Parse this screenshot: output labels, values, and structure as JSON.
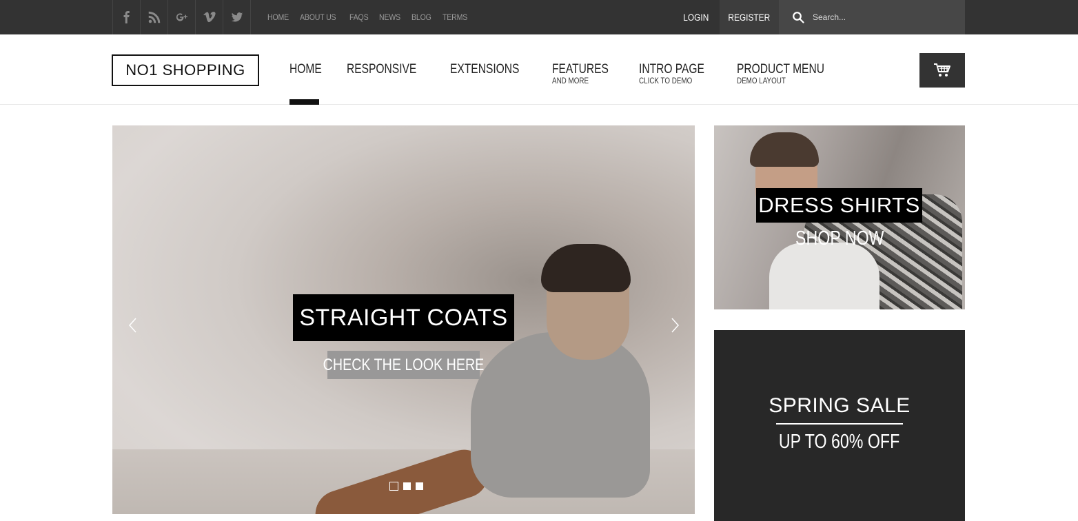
{
  "topbar": {
    "social_icons": [
      "facebook-icon",
      "rss-icon",
      "google-plus-icon",
      "vimeo-icon",
      "twitter-icon"
    ],
    "links": [
      "HOME",
      "ABOUT US",
      "FAQS",
      "NEWS",
      "BLOG",
      "TERMS"
    ],
    "login_label": "LOGIN",
    "register_label": "REGISTER",
    "search_placeholder": "Search..."
  },
  "header": {
    "logo": "NO1 SHOPPING",
    "nav": [
      {
        "label": "HOME",
        "sub": ""
      },
      {
        "label": "RESPONSIVE",
        "sub": ""
      },
      {
        "label": "EXTENSIONS",
        "sub": ""
      },
      {
        "label": "FEATURES",
        "sub": "AND MORE"
      },
      {
        "label": "INTRO PAGE",
        "sub": "CLICK TO DEMO"
      },
      {
        "label": "PRODUCT MENU",
        "sub": "DEMO LAYOUT"
      }
    ],
    "active_nav": "HOME",
    "cart_icon": "cart-icon"
  },
  "slider": {
    "caption": "STRAIGHT COATS",
    "cta": "CHECK THE LOOK HERE",
    "slide_count": 3,
    "active_slide": 1
  },
  "banners": {
    "first": {
      "title": "DRESS SHIRTS",
      "subtitle": "SHOP NOW"
    },
    "second": {
      "title": "SPRING SALE",
      "subtitle": "UP TO 60% OFF"
    }
  },
  "colors": {
    "topbar_bg": "#333333",
    "accent_dark": "#111111",
    "sale_bg": "#282828"
  }
}
